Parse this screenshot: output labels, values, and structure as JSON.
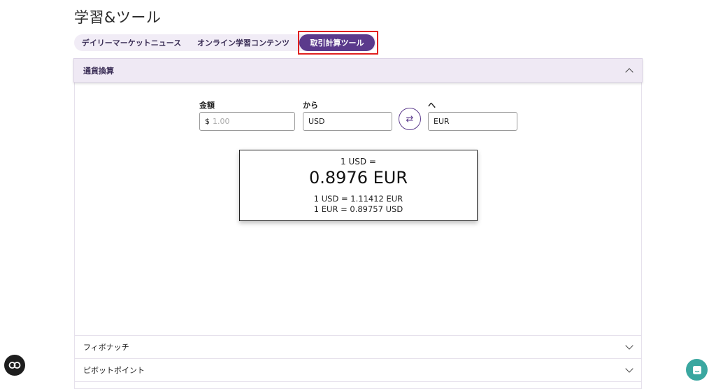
{
  "page": {
    "title": "学習&ツール"
  },
  "tabs": [
    {
      "label": "デイリーマーケットニュース"
    },
    {
      "label": "オンライン学習コンテンツ"
    },
    {
      "label": "取引計算ツール"
    }
  ],
  "converter": {
    "header": "通貨換算",
    "amount_label": "金額",
    "amount_prefix": "$",
    "amount_placeholder": "1.00",
    "from_label": "から",
    "from_value": "USD",
    "to_label": "へ",
    "to_value": "EUR",
    "swap_icon": "⇄",
    "result": {
      "line1": "1 USD =",
      "main": "0.8976 EUR",
      "line3": "1 USD = 1.11412 EUR",
      "line4": "1 EUR = 0.89757 USD"
    }
  },
  "accordion": [
    {
      "label": "フィボナッチ"
    },
    {
      "label": "ピボットポイント"
    }
  ],
  "colors": {
    "accent": "#5b3a8c",
    "highlight": "#e02020",
    "chat": "#3aa7a0"
  }
}
